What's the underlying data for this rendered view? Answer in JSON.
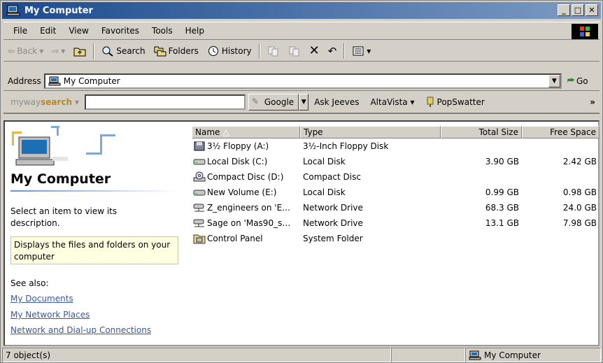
{
  "window": {
    "title": "My Computer"
  },
  "menu": [
    "File",
    "Edit",
    "View",
    "Favorites",
    "Tools",
    "Help"
  ],
  "toolbar": {
    "back": "Back",
    "search": "Search",
    "folders": "Folders",
    "history": "History"
  },
  "address": {
    "label": "Address",
    "value": "My Computer",
    "go": "Go"
  },
  "searchbar": {
    "logo_pre": "myway",
    "logo_bold": "search",
    "google": "Google",
    "links": [
      "Ask Jeeves",
      "AltaVista"
    ],
    "popswatter": "PopSwatter"
  },
  "leftpane": {
    "heading": "My Computer",
    "description": "Select an item to view its description.",
    "info": "Displays the files and folders on your computer",
    "see_also": "See also:",
    "links": [
      "My Documents",
      "My Network Places",
      "Network and Dial-up Connections"
    ]
  },
  "columns": {
    "name": "Name",
    "type": "Type",
    "total": "Total Size",
    "free": "Free Space"
  },
  "items": [
    {
      "icon": "floppy-icon",
      "name": "3½ Floppy (A:)",
      "type": "3½-Inch Floppy Disk",
      "total": "",
      "free": ""
    },
    {
      "icon": "local-disk-icon",
      "name": "Local Disk (C:)",
      "type": "Local Disk",
      "total": "3.90 GB",
      "free": "2.42 GB"
    },
    {
      "icon": "cd-icon",
      "name": "Compact Disc (D:)",
      "type": "Compact Disc",
      "total": "",
      "free": ""
    },
    {
      "icon": "local-disk-icon",
      "name": "New Volume (E:)",
      "type": "Local Disk",
      "total": "0.99 GB",
      "free": "0.98 GB"
    },
    {
      "icon": "network-drive-icon",
      "name": "Z_engineers on 'E…",
      "type": "Network Drive",
      "total": "68.3 GB",
      "free": "24.0 GB"
    },
    {
      "icon": "network-drive-icon",
      "name": "Sage on 'Mas90_s…",
      "type": "Network Drive",
      "total": "13.1 GB",
      "free": "7.98 GB"
    },
    {
      "icon": "control-panel-icon",
      "name": "Control Panel",
      "type": "System Folder",
      "total": "",
      "free": ""
    }
  ],
  "status": {
    "count": "7 object(s)",
    "zone": "My Computer"
  }
}
